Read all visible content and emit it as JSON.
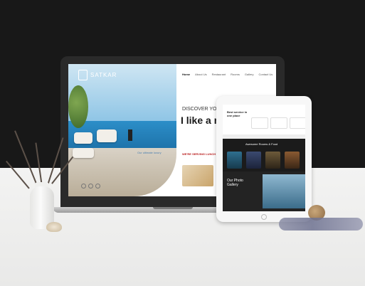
{
  "laptop_site": {
    "logo_text": "SATKAR",
    "nav": [
      "Home",
      "About Us",
      "Restaurant",
      "Rooms",
      "Gallery",
      "Contact Us"
    ],
    "eyebrow": "DISCOVER YOUR TA",
    "headline": "I like a m room.",
    "hero_link": "Our ultimate luxury",
    "lunch_title": "WE'RE SERVING LUNCH NOW"
  },
  "tablet_site": {
    "hero_text": "Best service in one place",
    "rooms_heading": "Awesome Rooms & Food",
    "gallery_heading": "Our Photo Gallery"
  },
  "icons": [
    "logo-icon",
    "arrow-right-icon",
    "social-icon"
  ]
}
